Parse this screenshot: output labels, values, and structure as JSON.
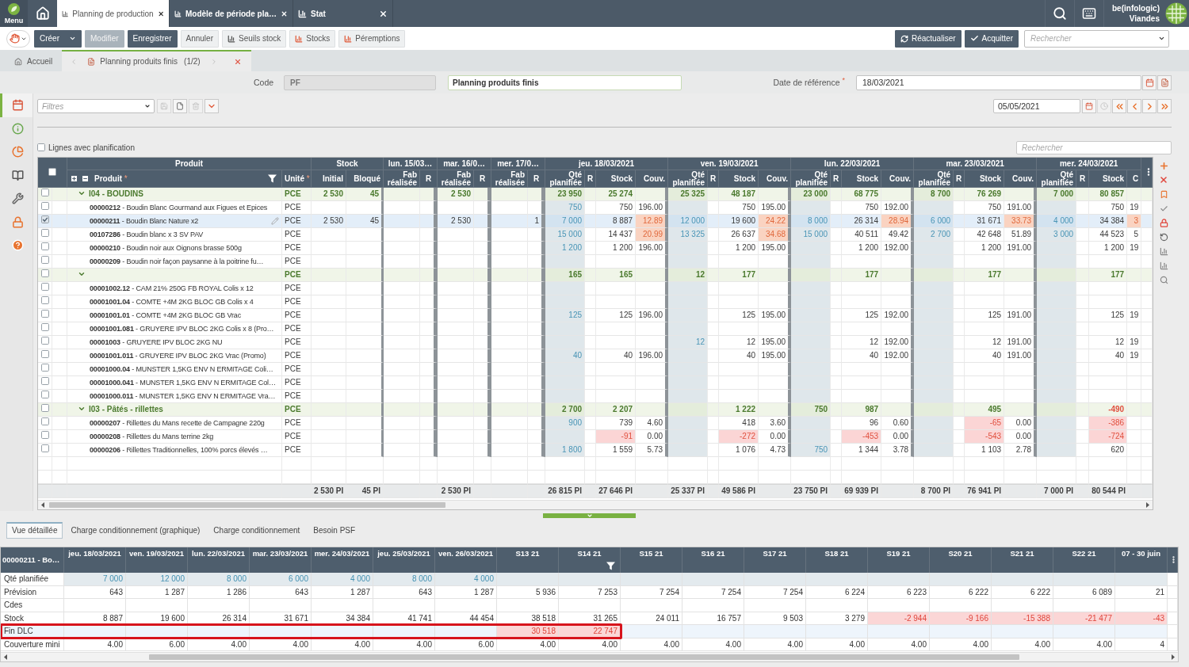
{
  "top_bar": {
    "menu_label": "Menu",
    "tabs": [
      {
        "label": "Planning de production",
        "selected": true
      },
      {
        "label": "Modèle de période pla…",
        "selected": false
      },
      {
        "label": "Stat",
        "selected": false
      }
    ],
    "user_name": "be(infologic)",
    "company": "Viandes"
  },
  "toolbar": {
    "buttons": [
      {
        "label": "Créer",
        "kind": "dropdown",
        "disabled": false
      },
      {
        "label": "Modifier",
        "kind": "primary",
        "disabled": true
      },
      {
        "label": "Enregistrer",
        "kind": "primary",
        "disabled": false
      },
      {
        "label": "Annuler",
        "kind": "plain",
        "disabled": false
      },
      {
        "label": "Seuils stock",
        "kind": "threshold",
        "disabled": false
      },
      {
        "label": "Stocks",
        "kind": "chart",
        "disabled": false
      },
      {
        "label": "Péremptions",
        "kind": "chart",
        "disabled": false
      }
    ],
    "actions": [
      {
        "label": "Réactualiser",
        "kind": "refresh"
      },
      {
        "label": "Acquitter",
        "kind": "confirm"
      }
    ],
    "search": {
      "placeholder": "Rechercher"
    }
  },
  "breadcrumb": {
    "tabs": [
      {
        "label": "Accueil",
        "kind": "home",
        "selected": false
      },
      {
        "label": "Planning produits finis",
        "counter": "(1/2)",
        "kind": "document",
        "selected": true
      }
    ]
  },
  "form": {
    "code_label": "Code",
    "code": "PF",
    "name": "Planning produits finis",
    "date_label": "Date de référence",
    "date_mark": "*",
    "date": "18/03/2021"
  },
  "sidebar": {
    "items": [
      {
        "selected": true
      },
      {
        "selected": false
      },
      {
        "selected": false
      },
      {
        "selected": false
      },
      {
        "selected": false
      },
      {
        "selected": false
      },
      {
        "selected": false
      }
    ]
  },
  "filters": {
    "placeholder": "Filtres",
    "actions": [
      {
        "kind": "save",
        "disabled": true
      },
      {
        "kind": "new",
        "disabled": false
      },
      {
        "kind": "delete",
        "disabled": true
      },
      {
        "kind": "menu",
        "disabled": false
      }
    ],
    "period_date": "05/05/2021",
    "period_actions": [
      {
        "kind": "calendar",
        "disabled": false
      },
      {
        "kind": "clock",
        "disabled": true
      },
      {
        "kind": "first",
        "disabled": false
      },
      {
        "kind": "previous",
        "disabled": false
      },
      {
        "kind": "next",
        "disabled": false
      },
      {
        "kind": "last",
        "disabled": false
      }
    ]
  },
  "options": {
    "planned_only": {
      "label": "Lignes avec planification",
      "checked": false
    },
    "search_placeholder": "Rechercher"
  },
  "grid": {
    "all_selected": false,
    "headers": {
      "product_group": "Produit",
      "product": "Produit",
      "product_mark": "*",
      "unit": "Unité",
      "unit_mark": "*",
      "stock_group": "Stock",
      "initial": "Initial",
      "blocked": "Bloqué"
    },
    "past_days": [
      {
        "label": "lun. 15/03…",
        "done": "Fab réalisée",
        "r": "R"
      },
      {
        "label": "mar. 16/0…",
        "done": "Fab réalisée",
        "r": "R"
      },
      {
        "label": "mer. 17/0…",
        "done": "Fab réalisée",
        "r": "R"
      }
    ],
    "days": [
      {
        "label": "jeu. 18/03/2021",
        "planned": "Qté planifiée",
        "r": "R",
        "stock": "Stock",
        "cover": "Couv."
      },
      {
        "label": "ven. 19/03/2021",
        "planned": "Qté planifiée",
        "r": "R",
        "stock": "Stock",
        "cover": "Couv."
      },
      {
        "label": "lun. 22/03/2021",
        "planned": "Qté planifiée",
        "r": "R",
        "stock": "Stock",
        "cover": "Couv."
      },
      {
        "label": "mar. 23/03/2021",
        "planned": "Qté planifiée",
        "r": "R",
        "stock": "Stock",
        "cover": "Couv."
      },
      {
        "label": "mer. 24/03/2021",
        "planned": "Qté planifiée",
        "r": "R",
        "stock": "Stock",
        "cover": "C"
      }
    ],
    "rows": [
      {
        "kind": "group",
        "expanded": true,
        "selected": false,
        "label": "I04 - BOUDINS",
        "unit": "PCE",
        "initial": "2 530",
        "blocked": "45",
        "past_2": {
          "done": "2 530"
        },
        "day_1": {
          "planned": "23 950",
          "stock": "25 274",
          "stock_alert": false
        },
        "day_2": {
          "planned": "25 325",
          "stock": "48 187",
          "stock_alert": false
        },
        "day_3": {
          "planned": "23 000",
          "stock": "68 775",
          "stock_alert": false
        },
        "day_4": {
          "planned": "8 700",
          "stock": "76 269",
          "stock_alert": false
        },
        "day_5": {
          "planned": "7 000",
          "stock": "80 857",
          "stock_alert": false
        }
      },
      {
        "kind": "product",
        "selected": false,
        "label": "**00000212** - Boudin Blanc Gourmand aux Figues et Epices",
        "unit": "PCE",
        "day_1": {
          "planned": "750",
          "stock": "750",
          "stock_alert": false,
          "cover": "196.00",
          "cover_alert": false
        },
        "day_2": {
          "stock": "750",
          "stock_alert": false,
          "cover": "195.00",
          "cover_alert": false
        },
        "day_3": {
          "stock": "750",
          "stock_alert": false,
          "cover": "192.00",
          "cover_alert": false
        },
        "day_4": {
          "stock": "750",
          "stock_alert": false,
          "cover": "191.00",
          "cover_alert": false
        },
        "day_5": {
          "stock": "750",
          "stock_alert": false,
          "cover": "19",
          "cover_alert": false
        }
      },
      {
        "kind": "product",
        "selected": true,
        "label": "**00000211** - Boudin Blanc Nature x2",
        "unit": "PCE",
        "initial": "2 530",
        "blocked": "45",
        "past_2": {
          "done": "2 530"
        },
        "past_3": {
          "r": "1"
        },
        "day_1": {
          "planned": "7 000",
          "stock": "8 887",
          "stock_alert": false,
          "cover": "12.89",
          "cover_alert": true
        },
        "day_2": {
          "planned": "12 000",
          "stock": "19 600",
          "stock_alert": false,
          "cover": "24.22",
          "cover_alert": true
        },
        "day_3": {
          "planned": "8 000",
          "stock": "26 314",
          "stock_alert": false,
          "cover": "28.94",
          "cover_alert": true
        },
        "day_4": {
          "planned": "6 000",
          "stock": "31 671",
          "stock_alert": false,
          "cover": "33.73",
          "cover_alert": true
        },
        "day_5": {
          "planned": "4 000",
          "stock": "34 384",
          "stock_alert": false,
          "cover": "3",
          "cover_alert": true
        }
      },
      {
        "kind": "product",
        "selected": false,
        "label": "**00107286** - Boudin blanc x 3 SV PAV",
        "unit": "PCE",
        "day_1": {
          "planned": "15 000",
          "stock": "14 437",
          "stock_alert": false,
          "cover": "20.99",
          "cover_alert": true
        },
        "day_2": {
          "planned": "13 325",
          "stock": "26 637",
          "stock_alert": false,
          "cover": "34.68",
          "cover_alert": true
        },
        "day_3": {
          "planned": "15 000",
          "stock": "40 511",
          "stock_alert": false,
          "cover": "49.42",
          "cover_alert": false
        },
        "day_4": {
          "planned": "2 700",
          "stock": "42 648",
          "stock_alert": false,
          "cover": "51.89",
          "cover_alert": false
        },
        "day_5": {
          "planned": "3 000",
          "stock": "44 523",
          "stock_alert": false,
          "cover": "5",
          "cover_alert": false
        }
      },
      {
        "kind": "product",
        "selected": false,
        "label": "**00000210** - Boudin noir aux Oignons brasse 500g",
        "unit": "PCE",
        "day_1": {
          "planned": "1 200",
          "stock": "1 200",
          "stock_alert": false,
          "cover": "196.00",
          "cover_alert": false
        },
        "day_2": {
          "stock": "1 200",
          "stock_alert": false,
          "cover": "195.00",
          "cover_alert": false
        },
        "day_3": {
          "stock": "1 200",
          "stock_alert": false,
          "cover": "192.00",
          "cover_alert": false
        },
        "day_4": {
          "stock": "1 200",
          "stock_alert": false,
          "cover": "191.00",
          "cover_alert": false
        },
        "day_5": {
          "stock": "1 200",
          "stock_alert": false,
          "cover": "19",
          "cover_alert": false
        }
      },
      {
        "kind": "product",
        "selected": false,
        "label": "**00000209** - Boudin noir façon paysanne à la poitrine fu…",
        "unit": "PCE"
      },
      {
        "kind": "group",
        "expanded": true,
        "selected": false,
        "unit": "PCE",
        "day_1": {
          "planned": "165",
          "stock": "165",
          "stock_alert": false
        },
        "day_2": {
          "planned": "12",
          "stock": "177",
          "stock_alert": false
        },
        "day_3": {
          "stock": "177",
          "stock_alert": false
        },
        "day_4": {
          "stock": "177",
          "stock_alert": false
        },
        "day_5": {
          "stock": "177",
          "stock_alert": false
        }
      },
      {
        "kind": "product",
        "selected": false,
        "label": "**00001002.12** - CAM 21% 250G FB ROYAL Colis x 12",
        "unit": "PCE"
      },
      {
        "kind": "product",
        "selected": false,
        "label": "**00001001.04** - COMTE +4M 2KG BLOC GB Colis x 4",
        "unit": "PCE"
      },
      {
        "kind": "product",
        "selected": false,
        "label": "**00001001.01** - COMTE +4M 2KG BLOC GB Vrac",
        "unit": "PCE",
        "day_1": {
          "planned": "125",
          "stock": "125",
          "stock_alert": false,
          "cover": "196.00",
          "cover_alert": false
        },
        "day_2": {
          "stock": "125",
          "stock_alert": false,
          "cover": "195.00",
          "cover_alert": false
        },
        "day_3": {
          "stock": "125",
          "stock_alert": false,
          "cover": "192.00",
          "cover_alert": false
        },
        "day_4": {
          "stock": "125",
          "stock_alert": false,
          "cover": "191.00",
          "cover_alert": false
        },
        "day_5": {
          "stock": "125",
          "stock_alert": false,
          "cover": "19",
          "cover_alert": false
        }
      },
      {
        "kind": "product",
        "selected": false,
        "label": "**00001001.081** - GRUYERE IPV BLOC 2KG Colis x 8 (Pro…",
        "unit": "PCE"
      },
      {
        "kind": "product",
        "selected": false,
        "label": "**00001003** - GRUYERE IPV BLOC 2KG NU",
        "unit": "PCE",
        "day_2": {
          "planned": "12",
          "stock": "12",
          "stock_alert": false,
          "cover": "195.00",
          "cover_alert": false
        },
        "day_3": {
          "stock": "12",
          "stock_alert": false,
          "cover": "192.00",
          "cover_alert": false
        },
        "day_4": {
          "stock": "12",
          "stock_alert": false,
          "cover": "191.00",
          "cover_alert": false
        },
        "day_5": {
          "stock": "12",
          "stock_alert": false,
          "cover": "19",
          "cover_alert": false
        }
      },
      {
        "kind": "product",
        "selected": false,
        "label": "**00001001.011** - GRUYERE IPV BLOC 2KG Vrac (Promo)",
        "unit": "PCE",
        "day_1": {
          "planned": "40",
          "stock": "40",
          "stock_alert": false,
          "cover": "196.00",
          "cover_alert": false
        },
        "day_2": {
          "stock": "40",
          "stock_alert": false,
          "cover": "195.00",
          "cover_alert": false
        },
        "day_3": {
          "stock": "40",
          "stock_alert": false,
          "cover": "192.00",
          "cover_alert": false
        },
        "day_4": {
          "stock": "40",
          "stock_alert": false,
          "cover": "191.00",
          "cover_alert": false
        },
        "day_5": {
          "stock": "40",
          "stock_alert": false,
          "cover": "19",
          "cover_alert": false
        }
      },
      {
        "kind": "product",
        "selected": false,
        "label": "**00001000.04** - MUNSTER 1,5KG ENV N ERMITAGE Coli…",
        "unit": "PCE"
      },
      {
        "kind": "product",
        "selected": false,
        "label": "**00001000.041** - MUNSTER 1,5KG ENV N ERMITAGE Col…",
        "unit": "PCE"
      },
      {
        "kind": "product",
        "selected": false,
        "label": "**00001000.011** - MUNSTER 1,5KG ENV N ERMITAGE Vra…",
        "unit": "PCE"
      },
      {
        "kind": "group",
        "expanded": true,
        "selected": false,
        "label": "I03 - Pâtés - rillettes",
        "unit": "PCE",
        "day_1": {
          "planned": "2 700",
          "stock": "2 207",
          "stock_alert": false
        },
        "day_2": {
          "stock": "1 222",
          "stock_alert": false
        },
        "day_3": {
          "planned": "750",
          "stock": "987",
          "stock_alert": false
        },
        "day_4": {
          "stock": "495",
          "stock_alert": false
        },
        "day_5": {
          "stock": "-490",
          "stock_alert": true
        }
      },
      {
        "kind": "product",
        "selected": false,
        "label": "**00000207** - Rillettes du Mans recette de Campagne 220g",
        "unit": "PCE",
        "day_1": {
          "planned": "900",
          "stock": "739",
          "stock_alert": false,
          "cover": "4.60",
          "cover_alert": false
        },
        "day_2": {
          "stock": "418",
          "stock_alert": false,
          "cover": "3.60",
          "cover_alert": false
        },
        "day_3": {
          "stock": "96",
          "stock_alert": false,
          "cover": "0.60",
          "cover_alert": false
        },
        "day_4": {
          "stock": "-65",
          "stock_alert": true,
          "cover": "0.00",
          "cover_alert": false
        },
        "day_5": {
          "stock": "-386",
          "stock_alert": true
        }
      },
      {
        "kind": "product",
        "selected": false,
        "label": "**00000208** - Rillettes du Mans terrine 2kg",
        "unit": "PCE",
        "day_1": {
          "stock": "-91",
          "stock_alert": true,
          "cover": "0.00",
          "cover_alert": false
        },
        "day_2": {
          "stock": "-272",
          "stock_alert": true,
          "cover": "0.00",
          "cover_alert": false
        },
        "day_3": {
          "stock": "-453",
          "stock_alert": true,
          "cover": "0.00",
          "cover_alert": false
        },
        "day_4": {
          "stock": "-543",
          "stock_alert": true,
          "cover": "0.00",
          "cover_alert": false
        },
        "day_5": {
          "stock": "-724",
          "stock_alert": true
        }
      },
      {
        "kind": "product",
        "selected": false,
        "label": "**00000206** - Rillettes Traditionnelles, 100% porcs élevés …",
        "unit": "PCE",
        "day_1": {
          "planned": "1 800",
          "stock": "1 559",
          "stock_alert": false,
          "cover": "5.73",
          "cover_alert": false
        },
        "day_2": {
          "stock": "1 076",
          "stock_alert": false,
          "cover": "4.73",
          "cover_alert": false
        },
        "day_3": {
          "planned": "750",
          "stock": "1 344",
          "stock_alert": false,
          "cover": "3.78",
          "cover_alert": false
        },
        "day_4": {
          "stock": "1 103",
          "stock_alert": false,
          "cover": "2.78",
          "cover_alert": false
        },
        "day_5": {
          "stock": "620",
          "stock_alert": false
        }
      }
    ],
    "totals": {
      "initial": "2 530 PI",
      "blocked": "45 PI",
      "past_2": {
        "done": "2 530 PI"
      },
      "day_1": {
        "planned": "26 815 PI",
        "stock": "27 646 PI"
      },
      "day_2": {
        "planned": "25 337 PI",
        "stock": "49 586 PI"
      },
      "day_3": {
        "planned": "23 750 PI",
        "stock": "69 939 PI"
      },
      "day_4": {
        "planned": "8 700 PI",
        "stock": "76 941 PI"
      },
      "day_5": {
        "planned": "7 000 PI",
        "stock": "80 544 PI"
      }
    }
  },
  "detail": {
    "tabs": [
      {
        "label": "Vue détaillée",
        "selected": true
      },
      {
        "label": "Charge conditionnement (graphique)",
        "selected": false
      },
      {
        "label": "Charge conditionnement",
        "selected": false
      },
      {
        "label": "Besoin PSF",
        "selected": false
      }
    ],
    "grid": {
      "corner": "00000211 - Bo…",
      "columns": [
        {
          "label": "jeu. 18/03/2021",
          "filter": false
        },
        {
          "label": "ven. 19/03/2021",
          "filter": false
        },
        {
          "label": "lun. 22/03/2021",
          "filter": false
        },
        {
          "label": "mar. 23/03/2021",
          "filter": false
        },
        {
          "label": "mer. 24/03/2021",
          "filter": false
        },
        {
          "label": "jeu. 25/03/2021",
          "filter": false
        },
        {
          "label": "ven. 26/03/2021",
          "filter": false
        },
        {
          "label": "S13 21",
          "filter": false
        },
        {
          "label": "S14 21",
          "filter": true
        },
        {
          "label": "S15 21",
          "filter": false
        },
        {
          "label": "S16 21",
          "filter": false
        },
        {
          "label": "S17 21",
          "filter": false
        },
        {
          "label": "S18 21",
          "filter": false
        },
        {
          "label": "S19 21",
          "filter": false
        },
        {
          "label": "S20 21",
          "filter": false
        },
        {
          "label": "S21 21",
          "filter": false
        },
        {
          "label": "S22 21",
          "filter": false
        },
        {
          "label": "07 - 30 juin",
          "filter": false
        }
      ],
      "rows": [
        {
          "label": "Qté planifiée",
          "kind": "planned",
          "highlighted": false,
          "cells": [
            {
              "text": "7 000",
              "alert": false
            },
            {
              "text": "12 000",
              "alert": false
            },
            {
              "text": "8 000",
              "alert": false
            },
            {
              "text": "6 000",
              "alert": false
            },
            {
              "text": "4 000",
              "alert": false
            },
            {
              "text": "8 000",
              "alert": false
            },
            {
              "text": "4 000",
              "alert": false
            }
          ]
        },
        {
          "label": "Prévision",
          "kind": "value",
          "highlighted": false,
          "cells": [
            {
              "text": "643",
              "alert": false
            },
            {
              "text": "1 287",
              "alert": false
            },
            {
              "text": "1 286",
              "alert": false
            },
            {
              "text": "643",
              "alert": false
            },
            {
              "text": "1 287",
              "alert": false
            },
            {
              "text": "643",
              "alert": false
            },
            {
              "text": "1 287",
              "alert": false
            },
            {
              "text": "5 936",
              "alert": false
            },
            {
              "text": "7 253",
              "alert": false
            },
            {
              "text": "7 254",
              "alert": false
            },
            {
              "text": "7 254",
              "alert": false
            },
            {
              "text": "7 254",
              "alert": false
            },
            {
              "text": "6 224",
              "alert": false
            },
            {
              "text": "6 223",
              "alert": false
            },
            {
              "text": "6 222",
              "alert": false
            },
            {
              "text": "6 222",
              "alert": false
            },
            {
              "text": "6 089",
              "alert": false
            },
            {
              "text": "21",
              "alert": false
            }
          ]
        },
        {
          "label": "Cdes",
          "kind": "value",
          "highlighted": false
        },
        {
          "label": "Stock",
          "kind": "value",
          "highlighted": false,
          "cells": [
            {
              "text": "8 887",
              "alert": false
            },
            {
              "text": "19 600",
              "alert": false
            },
            {
              "text": "26 314",
              "alert": false
            },
            {
              "text": "31 671",
              "alert": false
            },
            {
              "text": "34 384",
              "alert": false
            },
            {
              "text": "41 741",
              "alert": false
            },
            {
              "text": "44 454",
              "alert": false
            },
            {
              "text": "38 518",
              "alert": false
            },
            {
              "text": "31 265",
              "alert": false
            },
            {
              "text": "24 011",
              "alert": false
            },
            {
              "text": "16 757",
              "alert": false
            },
            {
              "text": "9 503",
              "alert": false
            },
            {
              "text": "3 279",
              "alert": false
            },
            {
              "text": "-2 944",
              "alert": true
            },
            {
              "text": "-9 166",
              "alert": true
            },
            {
              "text": "-15 388",
              "alert": true
            },
            {
              "text": "-21 477",
              "alert": true
            },
            {
              "text": "-43",
              "alert": true
            }
          ]
        },
        {
          "label": "Fin DLC",
          "kind": "expiry",
          "highlighted": true,
          "cells": [
            {
              "alert": false
            },
            {
              "alert": false
            },
            {
              "alert": false
            },
            {
              "alert": false
            },
            {
              "alert": false
            },
            {
              "alert": false
            },
            {
              "alert": false
            },
            {
              "text": "30 518",
              "alert": true
            },
            {
              "text": "22 747",
              "alert": true
            }
          ]
        },
        {
          "label": "Couverture mini",
          "kind": "value",
          "highlighted": false,
          "cells": [
            {
              "text": "4.00",
              "alert": false
            },
            {
              "text": "6.00",
              "alert": false
            },
            {
              "text": "4.00",
              "alert": false
            },
            {
              "text": "4.00",
              "alert": false
            },
            {
              "text": "4.00",
              "alert": false
            },
            {
              "text": "4.00",
              "alert": false
            },
            {
              "text": "6.00",
              "alert": false
            },
            {
              "text": "4.00",
              "alert": false
            },
            {
              "text": "4.00",
              "alert": false
            },
            {
              "text": "4.00",
              "alert": false
            },
            {
              "text": "4.00",
              "alert": false
            },
            {
              "text": "4.00",
              "alert": false
            },
            {
              "text": "4.00",
              "alert": false
            },
            {
              "text": "4.00",
              "alert": false
            },
            {
              "text": "4.00",
              "alert": false
            },
            {
              "text": "4.00",
              "alert": false
            },
            {
              "text": "4.00",
              "alert": false
            },
            {
              "text": "4",
              "alert": false
            }
          ]
        }
      ]
    }
  }
}
